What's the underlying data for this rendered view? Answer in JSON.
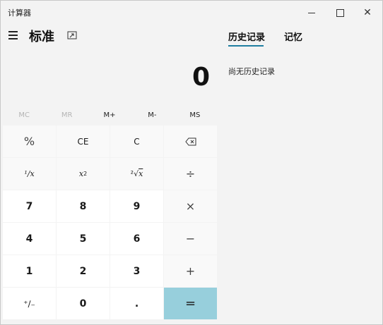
{
  "window": {
    "title": "计算器",
    "minimize_glyph": "—",
    "close_glyph": "✕"
  },
  "header": {
    "mode_title": "标准",
    "menu_icon": "hamburger-menu-icon",
    "keep_on_top_icon": "keep-on-top-icon"
  },
  "display": {
    "value": "0"
  },
  "memory": {
    "buttons": [
      {
        "label": "MC",
        "enabled": false
      },
      {
        "label": "MR",
        "enabled": false
      },
      {
        "label": "M+",
        "enabled": true
      },
      {
        "label": "M-",
        "enabled": true
      },
      {
        "label": "MS",
        "enabled": true
      }
    ]
  },
  "keys": {
    "percent": "%",
    "ce": "CE",
    "c": "C",
    "backspace_icon": "backspace-icon",
    "reciprocal": "¹∕x",
    "square_base": "x",
    "square_exp": "2",
    "sqrt_symbol": "²√",
    "sqrt_x": "x",
    "divide": "÷",
    "n7": "7",
    "n8": "8",
    "n9": "9",
    "multiply": "×",
    "n4": "4",
    "n5": "5",
    "n6": "6",
    "minus": "−",
    "n1": "1",
    "n2": "2",
    "n3": "3",
    "plus": "+",
    "negate": "⁺∕₋",
    "n0": "0",
    "decimal": ".",
    "equals": "="
  },
  "panel": {
    "tabs": [
      {
        "label": "历史记录",
        "active": true
      },
      {
        "label": "记忆",
        "active": false
      }
    ],
    "empty_message": "尚无历史记录"
  },
  "colors": {
    "accent": "#1f7ea1",
    "equals_key": "#97cfdc",
    "background": "#f3f3f3"
  }
}
